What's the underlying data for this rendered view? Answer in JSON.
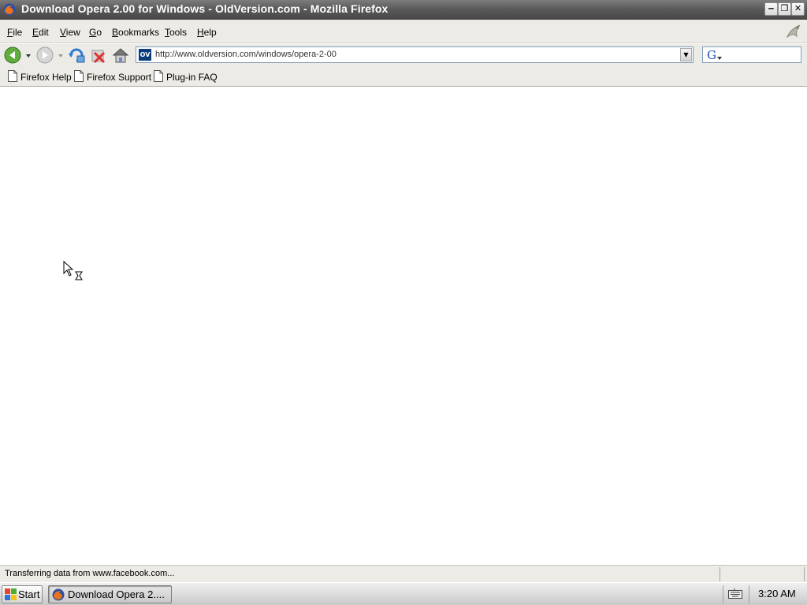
{
  "window": {
    "title": "Download Opera 2.00 for Windows - OldVersion.com - Mozilla Firefox",
    "minimize_glyph": "‒",
    "maximize_glyph": "❐",
    "close_glyph": "✕"
  },
  "menu": {
    "items": [
      {
        "first": "F",
        "rest": "ile"
      },
      {
        "first": "E",
        "rest": "dit"
      },
      {
        "first": "V",
        "rest": "iew"
      },
      {
        "first": "G",
        "rest": "o"
      },
      {
        "first": "B",
        "rest": "ookmarks"
      },
      {
        "first": "T",
        "rest": "ools"
      },
      {
        "first": "H",
        "rest": "elp"
      }
    ]
  },
  "navigation": {
    "site_icon_text": "OV",
    "url": "http://www.oldversion.com/windows/opera-2-00",
    "dropdown_glyph": "▼"
  },
  "bookmarks": {
    "items": [
      "Firefox Help",
      "Firefox Support",
      "Plug-in FAQ"
    ]
  },
  "status": {
    "text": "Transferring data from www.facebook.com..."
  },
  "taskbar": {
    "start_label": "Start",
    "task_label": "Download Opera 2....",
    "clock": "3:20 AM"
  },
  "colors": {
    "chrome": "#ecebe6",
    "titlebar": "#5a5a5a",
    "accent_blue": "#0a3b7a"
  }
}
